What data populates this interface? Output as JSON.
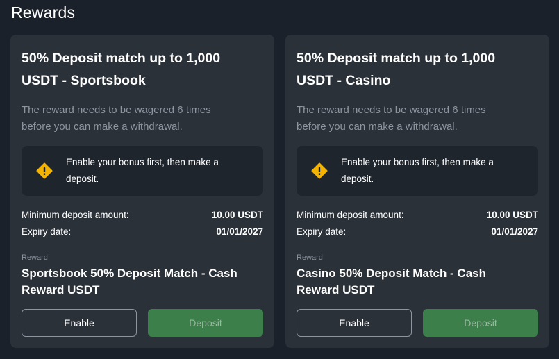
{
  "page": {
    "title": "Rewards"
  },
  "cards": [
    {
      "title_line1": "50% Deposit match up to 1,000",
      "title_line2": "USDT - Sportsbook",
      "description_line1": "The reward needs to be wagered 6 times",
      "description_line2": "before you can make a withdrawal.",
      "notice_icon": "warning-icon",
      "notice_line1": "Enable your bonus first, then make a",
      "notice_line2": "deposit.",
      "min_deposit_label": "Minimum deposit amount:",
      "min_deposit_value": "10.00 USDT",
      "expiry_label": "Expiry date:",
      "expiry_value": "01/01/2027",
      "reward_label": "Reward",
      "reward_name_line1": "Sportsbook 50% Deposit Match - Cash",
      "reward_name_line2": "Reward USDT",
      "enable_label": "Enable",
      "deposit_label": "Deposit"
    },
    {
      "title_line1": "50% Deposit match up to 1,000",
      "title_line2": "USDT - Casino",
      "description_line1": "The reward needs to be wagered 6 times",
      "description_line2": "before you can make a withdrawal.",
      "notice_icon": "warning-icon",
      "notice_line1": "Enable your bonus first, then make a",
      "notice_line2": "deposit.",
      "min_deposit_label": "Minimum deposit amount:",
      "min_deposit_value": "10.00 USDT",
      "expiry_label": "Expiry date:",
      "expiry_value": "01/01/2027",
      "reward_label": "Reward",
      "reward_name_line1": "Casino 50% Deposit Match - Cash",
      "reward_name_line2": "Reward USDT",
      "enable_label": "Enable",
      "deposit_label": "Deposit"
    }
  ],
  "colors": {
    "background": "#1b212a",
    "card": "#2b3139",
    "notice": "#1f252d",
    "warning": "#f5b301",
    "deposit_button": "#3c7f4a",
    "muted_text": "#8e959f"
  }
}
